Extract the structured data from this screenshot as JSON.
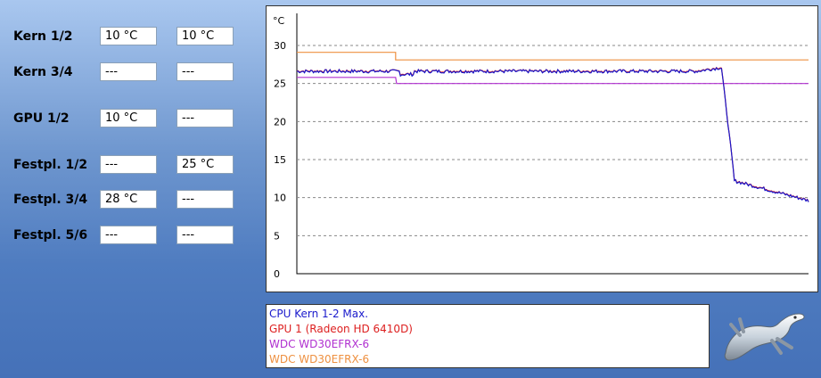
{
  "sensors": [
    {
      "label": "Kern 1/2",
      "v1": "10 °C",
      "v2": "10 °C"
    },
    {
      "label": "Kern 3/4",
      "v1": "---",
      "v2": "---"
    },
    {
      "label": "GPU 1/2",
      "v1": "10 °C",
      "v2": "---"
    },
    {
      "label": "Festpl. 1/2",
      "v1": "---",
      "v2": "25 °C"
    },
    {
      "label": "Festpl. 3/4",
      "v1": "28 °C",
      "v2": "---"
    },
    {
      "label": "Festpl. 5/6",
      "v1": "---",
      "v2": "---"
    }
  ],
  "chart_data": {
    "type": "line",
    "ylabel": "°C",
    "ylim": [
      0,
      30
    ],
    "yticks": [
      0,
      5,
      10,
      15,
      20,
      25,
      30
    ],
    "grid": "dashed horizontal",
    "series": [
      {
        "name": "CPU Kern 1-2 Max.",
        "color": "#1a1acc"
      },
      {
        "name": "GPU 1 (Radeon HD 6410D)",
        "color": "#dd2020"
      },
      {
        "name": "WDC WD30EFRX-6",
        "color": "#b030d0"
      },
      {
        "name": "WDC WD30EFRX-6",
        "color": "#ee9040"
      }
    ]
  },
  "legend": [
    {
      "text": "CPU Kern 1-2 Max.",
      "color": "#1a1acc"
    },
    {
      "text": "GPU 1 (Radeon HD 6410D)",
      "color": "#dd2020"
    },
    {
      "text": "WDC WD30EFRX-6",
      "color": "#b030d0"
    },
    {
      "text": "WDC WD30EFRX-6",
      "color": "#ee9040"
    }
  ]
}
